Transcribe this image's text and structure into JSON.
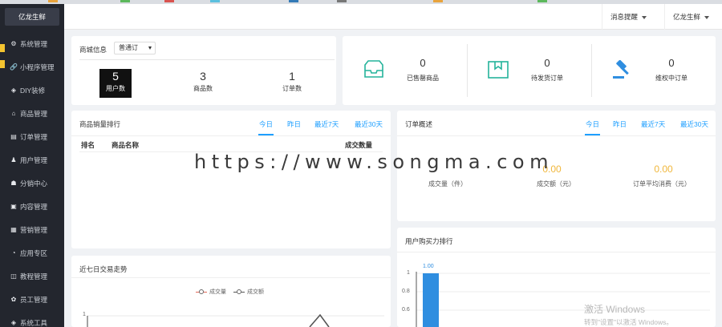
{
  "brand": "亿龙生鲜",
  "sidebar": {
    "items": [
      {
        "icon": "gear-icon",
        "glyph": "⚙",
        "label": "系统管理"
      },
      {
        "icon": "link-icon",
        "glyph": "🔗",
        "label": "小程序管理"
      },
      {
        "icon": "diy-icon",
        "glyph": "◈",
        "label": "DIY装修"
      },
      {
        "icon": "home-icon",
        "glyph": "⌂",
        "label": "商品管理"
      },
      {
        "icon": "order-icon",
        "glyph": "▤",
        "label": "订单管理"
      },
      {
        "icon": "user-icon",
        "glyph": "♟",
        "label": "用户管理"
      },
      {
        "icon": "distribution-icon",
        "glyph": "☗",
        "label": "分销中心"
      },
      {
        "icon": "content-icon",
        "glyph": "▣",
        "label": "内容管理"
      },
      {
        "icon": "marketing-icon",
        "glyph": "▦",
        "label": "营销管理"
      },
      {
        "icon": "app-icon",
        "glyph": "◔",
        "label": "应用专区"
      },
      {
        "icon": "tutorial-icon",
        "glyph": "◫",
        "label": "教程管理"
      },
      {
        "icon": "staff-icon",
        "glyph": "✿",
        "label": "员工管理"
      },
      {
        "icon": "tools-icon",
        "glyph": "◈",
        "label": "系统工具"
      }
    ]
  },
  "header": {
    "messages": "消息提醒",
    "user": "亿龙生鲜"
  },
  "shop_info": {
    "title": "商城信息",
    "select_value": "普通订",
    "stats": [
      {
        "value": "5",
        "label": "用户数",
        "active": true
      },
      {
        "value": "3",
        "label": "商品数",
        "active": false
      },
      {
        "value": "1",
        "label": "订单数",
        "active": false
      }
    ]
  },
  "order_stats": [
    {
      "icon": "tray-icon",
      "value": "0",
      "label": "已售罄商品"
    },
    {
      "icon": "shipping-box-icon",
      "value": "0",
      "label": "待发货订单"
    },
    {
      "icon": "gavel-icon",
      "value": "0",
      "label": "维权中订单"
    }
  ],
  "sales_rank": {
    "title": "商品销量排行",
    "tabs": [
      "今日",
      "昨日",
      "最近7天",
      "最近30天"
    ],
    "columns": [
      "排名",
      "商品名称",
      "成交数量"
    ]
  },
  "order_overview": {
    "title": "订单概述",
    "tabs": [
      "今日",
      "昨日",
      "最近7天",
      "最近30天"
    ],
    "stats": [
      {
        "value": "",
        "label": "成交量（件）"
      },
      {
        "value": "0.00",
        "label": "成交额（元）"
      },
      {
        "value": "0.00",
        "label": "订单平均消费（元）"
      }
    ]
  },
  "trend": {
    "title": "近七日交易走势",
    "legend": [
      "成交量",
      "成交额"
    ],
    "y_tick": "1"
  },
  "buying_power": {
    "title": "用户购买力排行",
    "bar_label": "1.00",
    "y_ticks": [
      "1",
      "0.8",
      "0.6"
    ]
  },
  "chart_data": [
    {
      "type": "line",
      "series": [
        {
          "name": "成交量"
        },
        {
          "name": "成交额"
        }
      ],
      "yticks": [
        "1"
      ]
    },
    {
      "type": "bar",
      "values": [
        1.0
      ],
      "ylim": [
        0.6,
        1
      ],
      "yticks": [
        1,
        0.8,
        0.6
      ],
      "data_labels": [
        "1.00"
      ]
    }
  ],
  "watermark": "https://www.songma.com",
  "windows_activation": {
    "line1": "激活 Windows",
    "line2": "转到\"设置\"以激活 Windows。"
  },
  "colors": {
    "sidebar": "#23262e",
    "accent": "#1e9fff",
    "teal": "#24b39b",
    "orange": "#f0b73c",
    "bar": "#2f8ee0"
  }
}
